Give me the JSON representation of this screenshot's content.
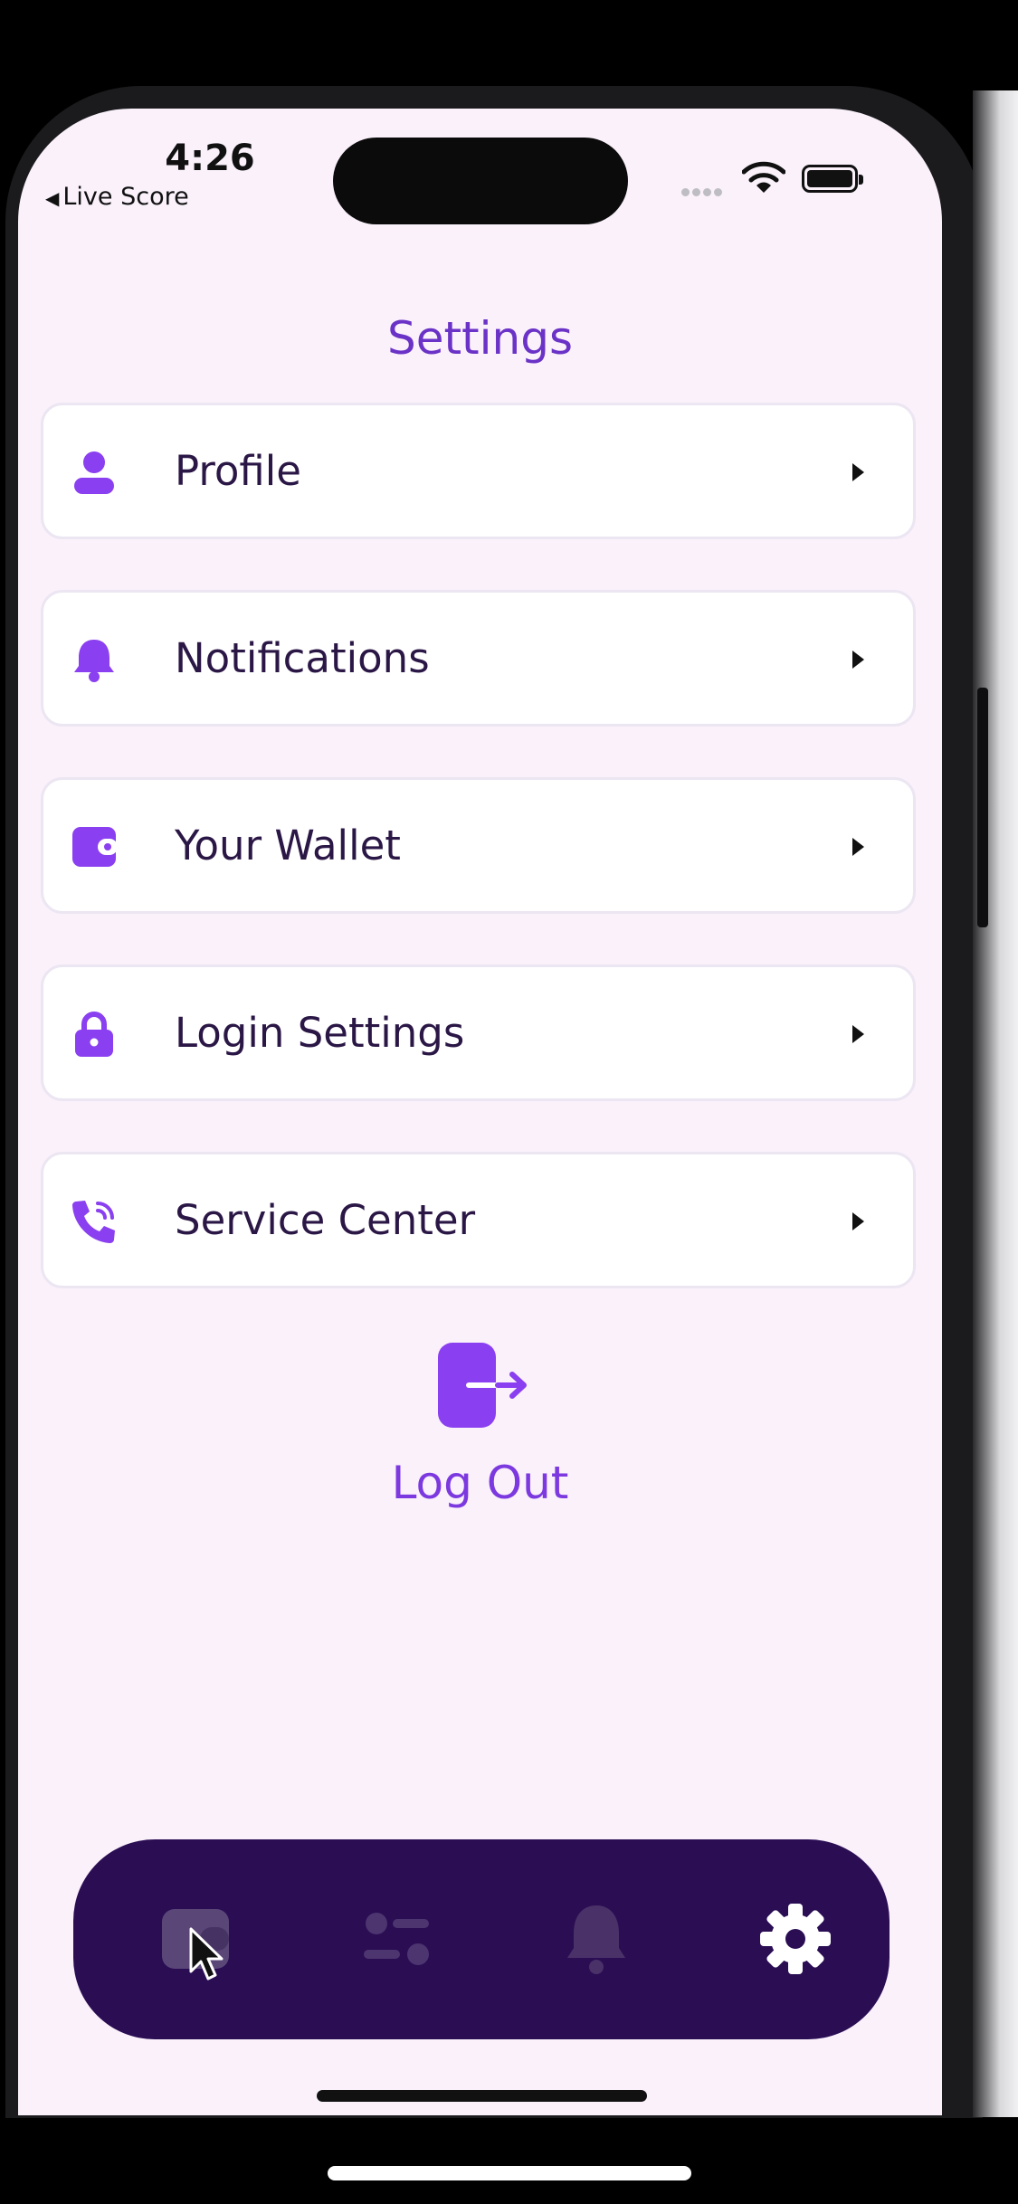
{
  "status_bar": {
    "time": "4:26",
    "back_label": "Live Score"
  },
  "header": {
    "title": "Settings"
  },
  "menu": {
    "items": [
      {
        "label": "Profile",
        "icon": "person-icon"
      },
      {
        "label": "Notifications",
        "icon": "bell-icon"
      },
      {
        "label": "Your Wallet",
        "icon": "wallet-icon"
      },
      {
        "label": "Login Settings",
        "icon": "lock-icon"
      },
      {
        "label": "Service Center",
        "icon": "phone-icon"
      }
    ]
  },
  "logout": {
    "label": "Log Out",
    "icon": "logout-icon"
  },
  "tab_bar": {
    "tabs": [
      {
        "icon": "wallet-icon",
        "active": false
      },
      {
        "icon": "sliders-icon",
        "active": false
      },
      {
        "icon": "bell-icon",
        "active": false
      },
      {
        "icon": "gear-icon",
        "active": true
      }
    ]
  },
  "colors": {
    "accent": "#8a3ff0",
    "title": "#6a32c6",
    "background": "#faf1fb",
    "tab_bar": "#2a0d53",
    "text": "#2b1746"
  }
}
